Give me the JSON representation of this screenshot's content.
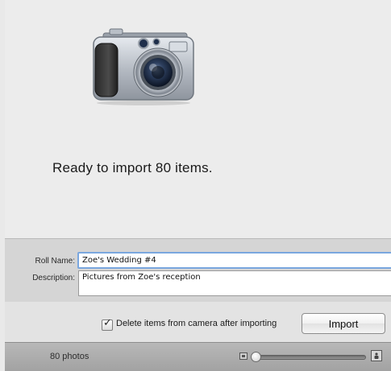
{
  "status": {
    "message": "Ready to import 80 items."
  },
  "form": {
    "roll_name_label": "Roll Name:",
    "roll_name_value": "Zoe's Wedding #4",
    "description_label": "Description:",
    "description_value": "Pictures from Zoe's reception"
  },
  "options": {
    "delete_after_import_label": "Delete items from camera after importing",
    "delete_after_import_checked": true,
    "import_button_label": "Import"
  },
  "footer": {
    "photo_count": "80 photos",
    "zoom_level": 0
  },
  "icons": {
    "camera": "camera-icon",
    "zoom_small": "small-thumbnail-icon",
    "zoom_large": "large-thumbnail-icon"
  },
  "colors": {
    "focus_ring": "#7aa7df"
  }
}
